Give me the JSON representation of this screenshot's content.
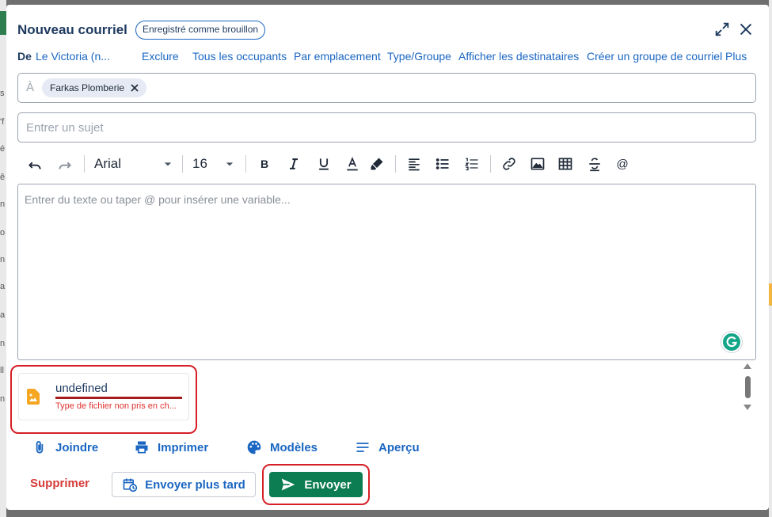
{
  "dialog": {
    "title": "Nouveau courriel",
    "status_badge": "Enregistré comme brouillon"
  },
  "from_row": {
    "label": "De",
    "sender": "Le Victoria (n...",
    "links": [
      "Exclure",
      "Tous les occupants",
      "Par emplacement",
      "Type/Groupe",
      "Afficher les destinataires",
      "Créer un groupe de courriel",
      "Plus"
    ]
  },
  "to_field": {
    "prefix": "À",
    "recipients": [
      "Farkas Plomberie"
    ]
  },
  "subject": {
    "placeholder": "Entrer un sujet",
    "value": ""
  },
  "toolbar": {
    "font_family": "Arial",
    "font_size": "16",
    "icons": [
      "undo-icon",
      "redo-icon",
      "bold-icon",
      "italic-icon",
      "underline-icon",
      "text-color-icon",
      "highlight-icon",
      "align-icon",
      "bullet-list-icon",
      "numbered-list-icon",
      "link-icon",
      "image-icon",
      "table-icon",
      "strikethrough-icon",
      "mention-icon"
    ]
  },
  "editor": {
    "placeholder": "Entrer du texte ou taper @ pour insérer une variable..."
  },
  "attachment": {
    "filename": "undefined",
    "error": "Type de fichier non pris en ch...",
    "icon": "image-file-icon"
  },
  "actions": {
    "attach": "Joindre",
    "print": "Imprimer",
    "templates": "Modèles",
    "preview": "Aperçu"
  },
  "footer": {
    "delete": "Supprimer",
    "send_later": "Envoyer plus tard",
    "send": "Envoyer"
  },
  "colors": {
    "link": "#1a66c2",
    "title": "#1e3a5f",
    "send_button": "#0c7c52",
    "delete": "#d63b3b",
    "error": "#e0332f",
    "highlight": "#d61f26"
  }
}
